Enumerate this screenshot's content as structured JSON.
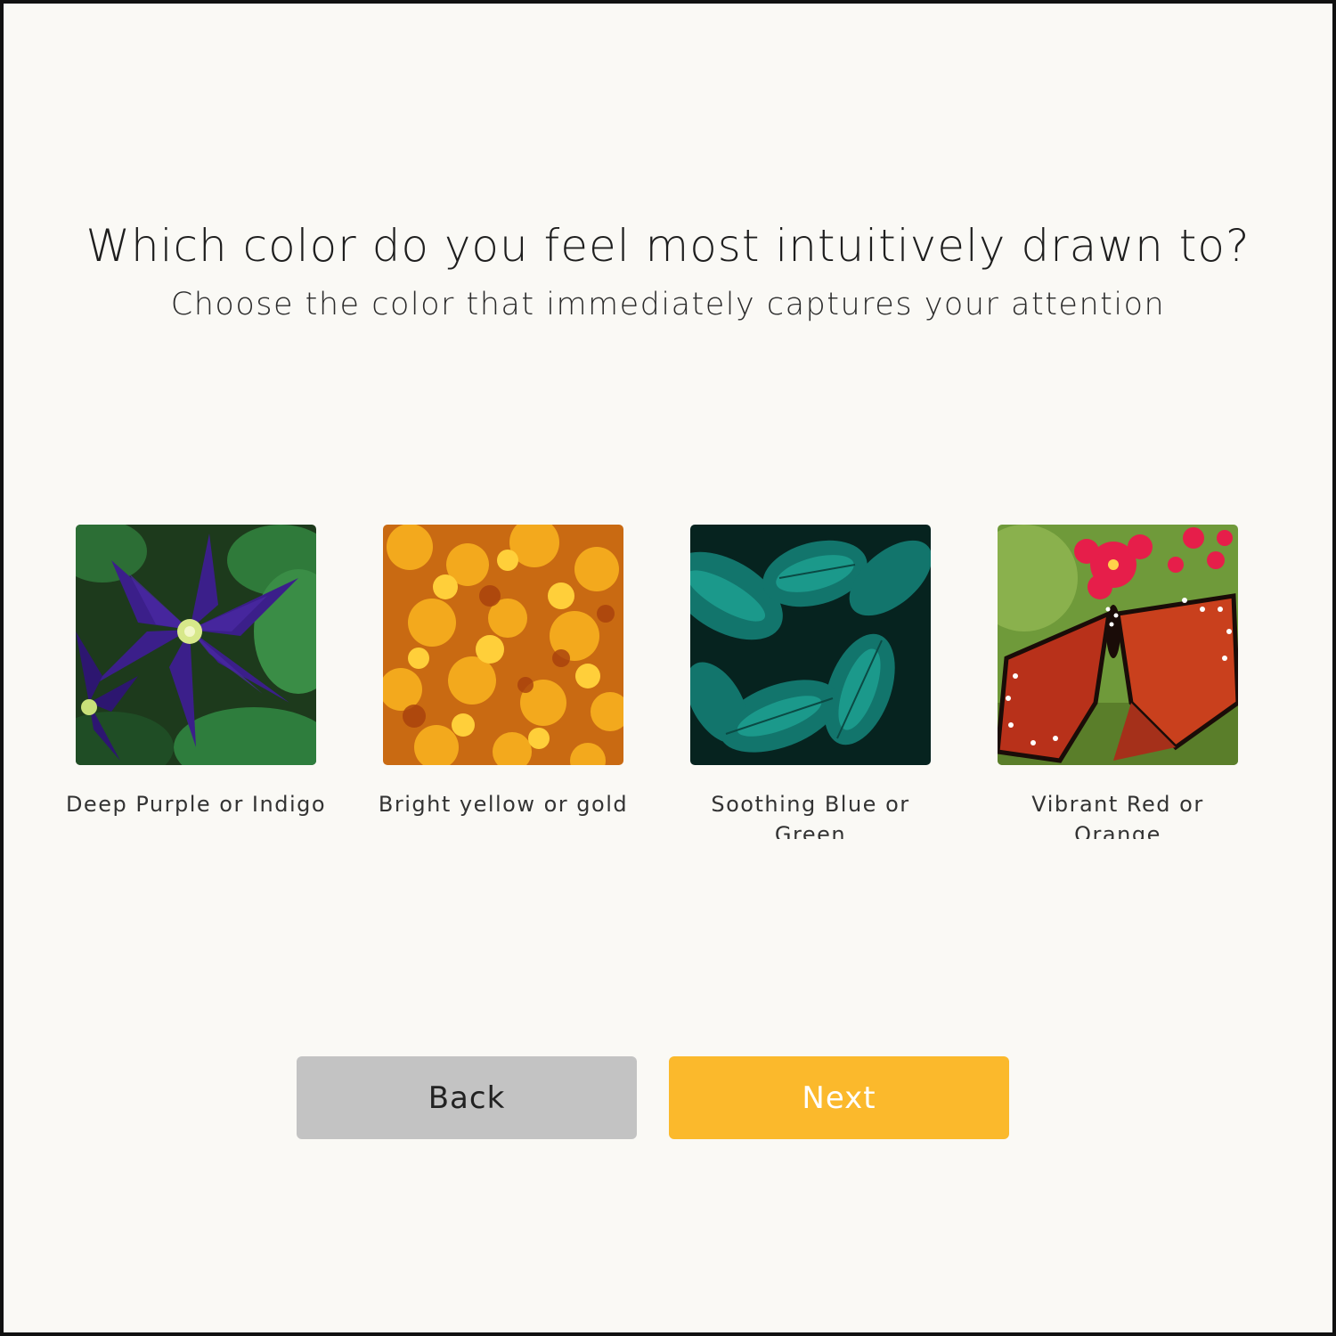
{
  "header": {
    "title": "Which color do you feel most intuitively drawn to?",
    "subtitle": "Choose the color that immediately captures your attention"
  },
  "options": [
    {
      "label": "Deep Purple or Indigo",
      "image": "purple-clematis-flower",
      "color": "#3a1f86"
    },
    {
      "label": "Bright yellow or gold",
      "image": "autumn-maple-leaves",
      "color": "#f2a114"
    },
    {
      "label": "Soothing Blue or Green",
      "image": "teal-tropical-leaves",
      "color": "#138a80"
    },
    {
      "label": "Vibrant Red or Orange",
      "image": "red-butterfly-on-flowers",
      "color": "#c8301a"
    }
  ],
  "buttons": {
    "back_label": "Back",
    "next_label": "Next"
  },
  "colors": {
    "background": "#faf9f5",
    "next_button": "#fbb92c",
    "back_button": "#c3c3c3"
  }
}
